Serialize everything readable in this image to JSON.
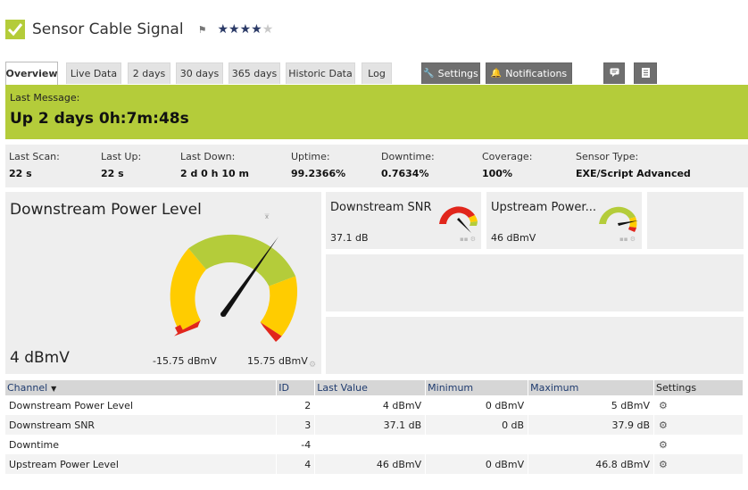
{
  "header": {
    "title": "Sensor Cable Signal",
    "status_icon": "check-icon",
    "flag_icon": "flag-icon",
    "rating": 4,
    "rating_max": 5
  },
  "tabs": [
    {
      "label": "Overview",
      "active": true
    },
    {
      "label": "Live Data"
    },
    {
      "label": "2 days"
    },
    {
      "label": "30 days"
    },
    {
      "label": "365 days"
    },
    {
      "label": "Historic Data"
    },
    {
      "label": "Log"
    },
    {
      "label": "Settings",
      "icon": "wrench-icon"
    },
    {
      "label": "Notifications",
      "icon": "bell-icon"
    }
  ],
  "last_message": {
    "label": "Last Message:",
    "value": "Up 2 days 0h:7m:48s",
    "color": "#b4cc3a"
  },
  "stats": [
    {
      "label": "Last Scan:",
      "value": "22 s"
    },
    {
      "label": "Last Up:",
      "value": "22 s"
    },
    {
      "label": "Last Down:",
      "value": "2 d 0 h 10 m"
    },
    {
      "label": "Uptime:",
      "value": "99.2366%"
    },
    {
      "label": "Downtime:",
      "value": "0.7634%"
    },
    {
      "label": "Coverage:",
      "value": "100%"
    },
    {
      "label": "Sensor Type:",
      "value": "EXE/Script Advanced"
    }
  ],
  "gauges": {
    "primary": {
      "title": "Downstream Power Level",
      "value": "4 dBmV",
      "min_label": "-15.75 dBmV",
      "max_label": "15.75 dBmV",
      "min": -15.75,
      "max": 15.75,
      "current": 4
    },
    "snr": {
      "title": "Downstream SNR",
      "value": "37.1 dB"
    },
    "upstream": {
      "title": "Upstream Power...",
      "value": "46 dBmV"
    }
  },
  "table": {
    "headers": {
      "channel": "Channel",
      "id": "ID",
      "last_value": "Last Value",
      "minimum": "Minimum",
      "maximum": "Maximum",
      "settings": "Settings"
    },
    "rows": [
      {
        "channel": "Downstream Power Level",
        "id": "2",
        "last_value": "4 dBmV",
        "minimum": "0 dBmV",
        "maximum": "5 dBmV"
      },
      {
        "channel": "Downstream SNR",
        "id": "3",
        "last_value": "37.1 dB",
        "minimum": "0 dB",
        "maximum": "37.9 dB"
      },
      {
        "channel": "Downtime",
        "id": "-4",
        "last_value": "",
        "minimum": "",
        "maximum": ""
      },
      {
        "channel": "Upstream Power Level",
        "id": "4",
        "last_value": "46 dBmV",
        "minimum": "0 dBmV",
        "maximum": "46.8 dBmV"
      }
    ]
  }
}
